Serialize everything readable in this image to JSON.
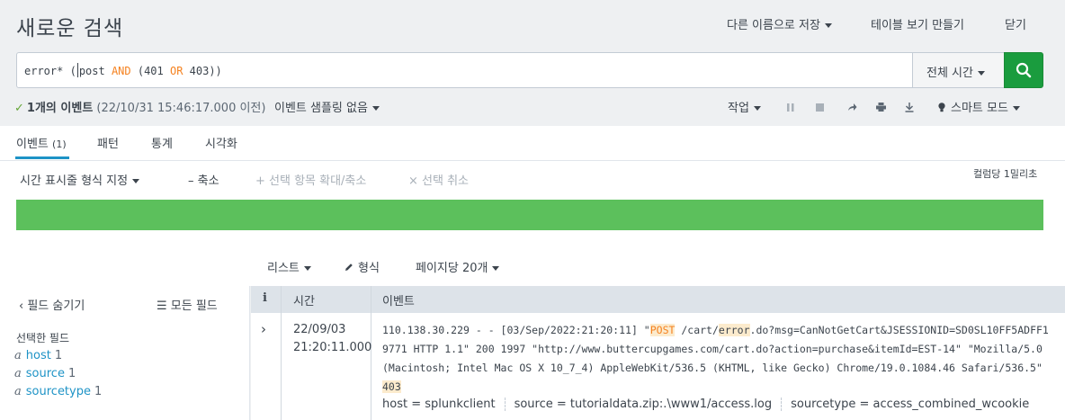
{
  "header": {
    "title": "새로운 검색",
    "save_as": "다른 이름으로 저장",
    "create_table_view": "테이블 보기 만들기",
    "close": "닫기"
  },
  "search": {
    "query_prefix": "error* ",
    "query_paren_open": "(",
    "query_post": "post ",
    "query_and": "AND",
    "query_mid": " (401 ",
    "query_or": "OR",
    "query_end": " 403))",
    "time_range": "전체 시간",
    "submit_icon": "search-icon",
    "accent_color": "#1a9c3e"
  },
  "status": {
    "count": "1개의 이벤트",
    "timestamp": "(22/10/31 15:46:17.000 이전)",
    "sampling": "이벤트 샘플링 없음",
    "job": "작업",
    "mode": "스마트 모드",
    "icons": [
      "pause-icon",
      "stop-icon",
      "share-icon",
      "print-icon",
      "download-icon",
      "bulb-icon"
    ]
  },
  "tabs": [
    {
      "label": "이벤트",
      "count": "(1)"
    },
    {
      "label": "패턴"
    },
    {
      "label": "통계"
    },
    {
      "label": "시각화"
    }
  ],
  "timeline": {
    "format": "시간 표시줄 형식 지정",
    "zoom_out": "축소",
    "zoom_to_selection": "선택 항목 확대/축소",
    "deselect": "선택 취소",
    "scale": "컬럼당 1밀리초",
    "bar_color": "#5cc05c"
  },
  "results_bar": {
    "list": "리스트",
    "format": "형식",
    "per_page": "페이지당 20개"
  },
  "sidebar": {
    "hide_fields": "필드 숨기기",
    "all_fields": "모든 필드",
    "selected_heading": "선택한 필드",
    "fields": [
      {
        "name": "host",
        "count": "1"
      },
      {
        "name": "source",
        "count": "1"
      },
      {
        "name": "sourcetype",
        "count": "1"
      }
    ]
  },
  "table": {
    "col_info": "i",
    "col_time": "시간",
    "col_event": "이벤트",
    "rows": [
      {
        "date": "22/09/03",
        "time": "21:20:11.000",
        "raw_1": "110.138.30.229 - - [03/Sep/2022:21:20:11] \"",
        "raw_post": "POST",
        "raw_2": " /cart/",
        "raw_error": "error",
        "raw_3": ".do?msg=CanNotGetCart&JSESSIONID=SD0SL10FF5ADFF19771 HTTP 1.1\" 200 1997 \"http://www.buttercupgames.com/cart.do?action=purchase&itemId=EST-14\" \"Mozilla/5.0 (Macintosh; Intel Mac OS X 10_7_4) AppleWebKit/536.5 (KHTML, like Gecko) Chrome/19.0.1084.46 Safari/536.5\" ",
        "raw_403": "403",
        "host": "host = splunkclient",
        "source": "source = tutorialdata.zip:.\\www1/access.log",
        "sourcetype": "sourcetype = access_combined_wcookie"
      }
    ]
  }
}
